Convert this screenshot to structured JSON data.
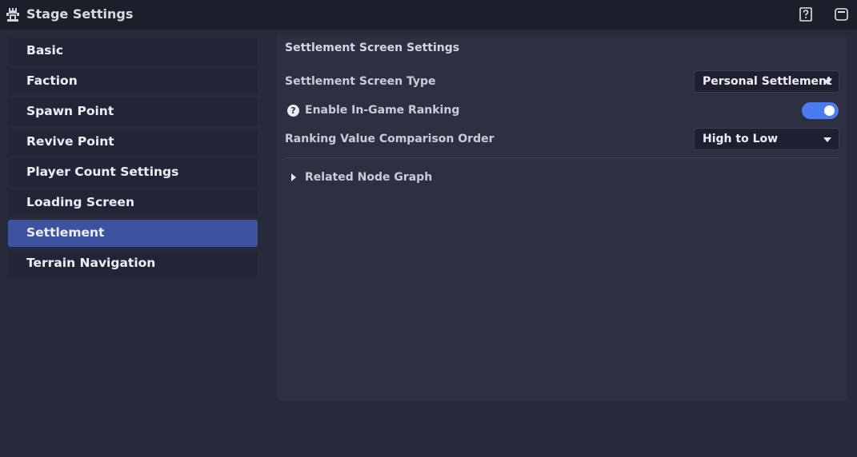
{
  "window": {
    "title": "Stage Settings",
    "icons": {
      "app": "castle-icon",
      "help": "help-icon",
      "window": "window-icon"
    }
  },
  "sidebar": {
    "items": [
      {
        "label": "Basic",
        "active": false
      },
      {
        "label": "Faction",
        "active": false
      },
      {
        "label": "Spawn Point",
        "active": false
      },
      {
        "label": "Revive Point",
        "active": false
      },
      {
        "label": "Player Count Settings",
        "active": false
      },
      {
        "label": "Loading Screen",
        "active": false
      },
      {
        "label": "Settlement",
        "active": true
      },
      {
        "label": "Terrain Navigation",
        "active": false
      }
    ]
  },
  "main": {
    "section_title": "Settlement Screen Settings",
    "settlement_type": {
      "label": "Settlement Screen Type",
      "value": "Personal Settlement"
    },
    "ranking": {
      "label": "Enable In-Game Ranking",
      "help_glyph": "?",
      "enabled": true
    },
    "order": {
      "label": "Ranking Value Comparison Order",
      "value": "High to Low"
    },
    "related": {
      "label": "Related Node Graph",
      "expanded": false
    }
  },
  "colors": {
    "accent": "#4a7cf0",
    "active_item": "#3c54a0",
    "background": "#272a3a",
    "titlebar": "#1c1e2b",
    "panel": "#2c3041"
  }
}
